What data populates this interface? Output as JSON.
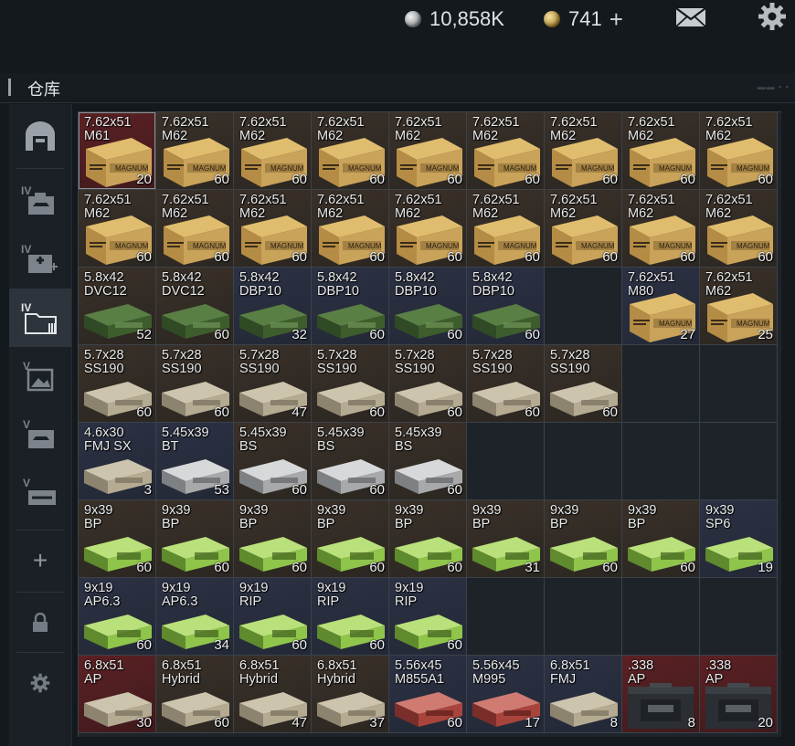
{
  "currency": {
    "silver": "10,858K",
    "gold": "741",
    "gold_add": "+"
  },
  "title": "仓库",
  "sidebar": {
    "items": [
      {
        "id": "main",
        "icon": "stash-icon",
        "label": ""
      },
      {
        "id": "s1",
        "icon": "weapon-case-icon",
        "label": "IV"
      },
      {
        "id": "s2",
        "icon": "medical-case-icon",
        "label": "IV"
      },
      {
        "id": "s3",
        "icon": "ammo-case-icon",
        "label": "IV"
      },
      {
        "id": "s4",
        "icon": "image-case-icon",
        "label": "V"
      },
      {
        "id": "s5",
        "icon": "weapon-case-icon",
        "label": "V"
      },
      {
        "id": "s6",
        "icon": "gun-case-icon",
        "label": "V"
      }
    ],
    "add": "+"
  },
  "colors": {
    "bg": "#14191e",
    "gold_box": "#c9a35a",
    "green_box": "#3e5d2c",
    "tan_box": "#b5ab92",
    "silver_box": "#a7a9ab",
    "lime_box": "#8fc54b",
    "red_tint": "#5a1f22",
    "blue_tint": "#2a3346"
  },
  "rows": [
    [
      {
        "n1": "7.62x51",
        "n2": "M61",
        "q": "20",
        "t": "gold",
        "bg": "red"
      },
      {
        "n1": "7.62x51",
        "n2": "M62",
        "q": "60",
        "t": "gold",
        "bg": "brown"
      },
      {
        "n1": "7.62x51",
        "n2": "M62",
        "q": "60",
        "t": "gold",
        "bg": "brown"
      },
      {
        "n1": "7.62x51",
        "n2": "M62",
        "q": "60",
        "t": "gold",
        "bg": "brown"
      },
      {
        "n1": "7.62x51",
        "n2": "M62",
        "q": "60",
        "t": "gold",
        "bg": "brown"
      },
      {
        "n1": "7.62x51",
        "n2": "M62",
        "q": "60",
        "t": "gold",
        "bg": "brown"
      },
      {
        "n1": "7.62x51",
        "n2": "M62",
        "q": "60",
        "t": "gold",
        "bg": "brown"
      },
      {
        "n1": "7.62x51",
        "n2": "M62",
        "q": "60",
        "t": "gold",
        "bg": "brown"
      },
      {
        "n1": "7.62x51",
        "n2": "M62",
        "q": "60",
        "t": "gold",
        "bg": "brown"
      }
    ],
    [
      {
        "n1": "7.62x51",
        "n2": "M62",
        "q": "60",
        "t": "gold",
        "bg": "brown"
      },
      {
        "n1": "7.62x51",
        "n2": "M62",
        "q": "60",
        "t": "gold",
        "bg": "brown"
      },
      {
        "n1": "7.62x51",
        "n2": "M62",
        "q": "60",
        "t": "gold",
        "bg": "brown"
      },
      {
        "n1": "7.62x51",
        "n2": "M62",
        "q": "60",
        "t": "gold",
        "bg": "brown"
      },
      {
        "n1": "7.62x51",
        "n2": "M62",
        "q": "60",
        "t": "gold",
        "bg": "brown"
      },
      {
        "n1": "7.62x51",
        "n2": "M62",
        "q": "60",
        "t": "gold",
        "bg": "brown"
      },
      {
        "n1": "7.62x51",
        "n2": "M62",
        "q": "60",
        "t": "gold",
        "bg": "brown"
      },
      {
        "n1": "7.62x51",
        "n2": "M62",
        "q": "60",
        "t": "gold",
        "bg": "brown"
      },
      {
        "n1": "7.62x51",
        "n2": "M62",
        "q": "60",
        "t": "gold",
        "bg": "brown"
      }
    ],
    [
      {
        "n1": "5.8x42",
        "n2": "DVC12",
        "q": "52",
        "t": "green",
        "bg": "brown"
      },
      {
        "n1": "5.8x42",
        "n2": "DVC12",
        "q": "60",
        "t": "green",
        "bg": "brown"
      },
      {
        "n1": "5.8x42",
        "n2": "DBP10",
        "q": "32",
        "t": "green",
        "bg": "blue"
      },
      {
        "n1": "5.8x42",
        "n2": "DBP10",
        "q": "60",
        "t": "green",
        "bg": "blue"
      },
      {
        "n1": "5.8x42",
        "n2": "DBP10",
        "q": "60",
        "t": "green",
        "bg": "blue"
      },
      {
        "n1": "5.8x42",
        "n2": "DBP10",
        "q": "60",
        "t": "green",
        "bg": "blue"
      },
      null,
      {
        "n1": "7.62x51",
        "n2": "M80",
        "q": "27",
        "t": "gold",
        "bg": "blue"
      },
      {
        "n1": "7.62x51",
        "n2": "M62",
        "q": "25",
        "t": "gold",
        "bg": "brown"
      }
    ],
    [
      {
        "n1": "5.7x28",
        "n2": "SS190",
        "q": "60",
        "t": "tan",
        "bg": "brown"
      },
      {
        "n1": "5.7x28",
        "n2": "SS190",
        "q": "60",
        "t": "tan",
        "bg": "brown"
      },
      {
        "n1": "5.7x28",
        "n2": "SS190",
        "q": "47",
        "t": "tan",
        "bg": "brown"
      },
      {
        "n1": "5.7x28",
        "n2": "SS190",
        "q": "60",
        "t": "tan",
        "bg": "brown"
      },
      {
        "n1": "5.7x28",
        "n2": "SS190",
        "q": "60",
        "t": "tan",
        "bg": "brown"
      },
      {
        "n1": "5.7x28",
        "n2": "SS190",
        "q": "60",
        "t": "tan",
        "bg": "brown"
      },
      {
        "n1": "5.7x28",
        "n2": "SS190",
        "q": "60",
        "t": "tan",
        "bg": "brown"
      },
      null,
      null
    ],
    [
      {
        "n1": "4.6x30",
        "n2": "FMJ SX",
        "q": "3",
        "t": "tan",
        "bg": "blue"
      },
      {
        "n1": "5.45x39",
        "n2": "BT",
        "q": "53",
        "t": "silver",
        "bg": "blue"
      },
      {
        "n1": "5.45x39",
        "n2": "BS",
        "q": "60",
        "t": "silver",
        "bg": "brown"
      },
      {
        "n1": "5.45x39",
        "n2": "BS",
        "q": "60",
        "t": "silver",
        "bg": "brown"
      },
      {
        "n1": "5.45x39",
        "n2": "BS",
        "q": "60",
        "t": "silver",
        "bg": "brown"
      },
      null,
      null,
      null,
      null
    ],
    [
      {
        "n1": "9x39",
        "n2": "BP",
        "q": "60",
        "t": "lime",
        "bg": "brown"
      },
      {
        "n1": "9x39",
        "n2": "BP",
        "q": "60",
        "t": "lime",
        "bg": "brown"
      },
      {
        "n1": "9x39",
        "n2": "BP",
        "q": "60",
        "t": "lime",
        "bg": "brown"
      },
      {
        "n1": "9x39",
        "n2": "BP",
        "q": "60",
        "t": "lime",
        "bg": "brown"
      },
      {
        "n1": "9x39",
        "n2": "BP",
        "q": "60",
        "t": "lime",
        "bg": "brown"
      },
      {
        "n1": "9x39",
        "n2": "BP",
        "q": "31",
        "t": "lime",
        "bg": "brown"
      },
      {
        "n1": "9x39",
        "n2": "BP",
        "q": "60",
        "t": "lime",
        "bg": "brown"
      },
      {
        "n1": "9x39",
        "n2": "BP",
        "q": "60",
        "t": "lime",
        "bg": "brown"
      },
      {
        "n1": "9x39",
        "n2": "SP6",
        "q": "19",
        "t": "lime",
        "bg": "blue"
      }
    ],
    [
      {
        "n1": "9x19",
        "n2": "AP6.3",
        "q": "60",
        "t": "lime",
        "bg": "blue"
      },
      {
        "n1": "9x19",
        "n2": "AP6.3",
        "q": "34",
        "t": "lime",
        "bg": "blue"
      },
      {
        "n1": "9x19",
        "n2": "RIP",
        "q": "60",
        "t": "lime",
        "bg": "blue"
      },
      {
        "n1": "9x19",
        "n2": "RIP",
        "q": "60",
        "t": "lime",
        "bg": "blue"
      },
      {
        "n1": "9x19",
        "n2": "RIP",
        "q": "60",
        "t": "lime",
        "bg": "blue"
      },
      null,
      null,
      null,
      null
    ],
    [
      {
        "n1": "6.8x51",
        "n2": "AP",
        "q": "30",
        "t": "tan",
        "bg": "red"
      },
      {
        "n1": "6.8x51",
        "n2": "Hybrid",
        "q": "60",
        "t": "tan",
        "bg": "brown"
      },
      {
        "n1": "6.8x51",
        "n2": "Hybrid",
        "q": "47",
        "t": "tan",
        "bg": "brown"
      },
      {
        "n1": "6.8x51",
        "n2": "Hybrid",
        "q": "37",
        "t": "tan",
        "bg": "brown"
      },
      {
        "n1": "5.56x45",
        "n2": "M855A1",
        "q": "60",
        "t": "red",
        "bg": "blue"
      },
      {
        "n1": "5.56x45",
        "n2": "M995",
        "q": "17",
        "t": "red",
        "bg": "blue"
      },
      {
        "n1": "6.8x51",
        "n2": "FMJ",
        "q": "8",
        "t": "tan",
        "bg": "blue"
      },
      {
        "n1": ".338",
        "n2": "AP",
        "q": "8",
        "t": "ammocan",
        "bg": "red"
      },
      {
        "n1": ".338",
        "n2": "AP",
        "q": "20",
        "t": "ammocan",
        "bg": "red"
      }
    ]
  ]
}
